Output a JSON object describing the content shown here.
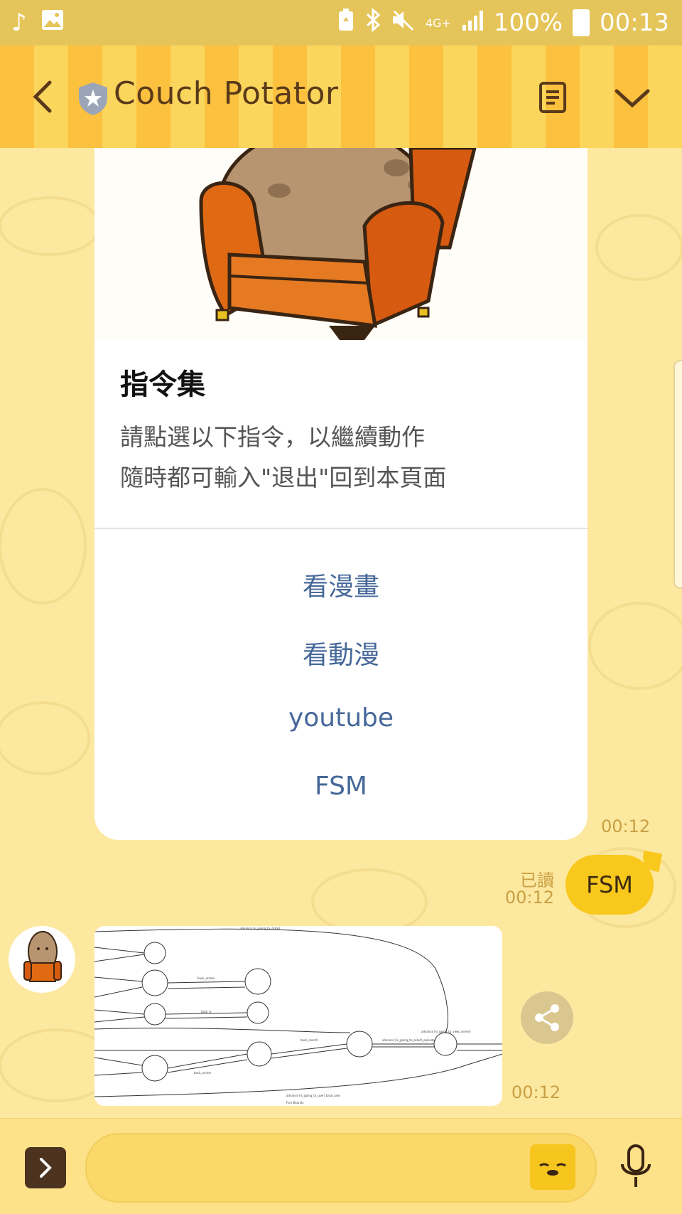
{
  "status_bar": {
    "network": "4G+",
    "battery": "100%",
    "time": "00:13"
  },
  "header": {
    "title": "Couch Potator"
  },
  "card": {
    "title": "指令集",
    "description_line1": "請點選以下指令，以繼續動作",
    "description_line2": "隨時都可輸入\"退出\"回到本頁面",
    "actions": [
      "看漫畫",
      "看動漫",
      "youtube",
      "FSM"
    ],
    "time": "00:12"
  },
  "sent_message": {
    "text": "FSM",
    "read_label": "已讀",
    "time": "00:12"
  },
  "image_message": {
    "time": "00:12"
  },
  "colors": {
    "accent": "#f8c81d",
    "link": "#46689a",
    "header_stripe_a": "#fbc13f",
    "header_stripe_b": "#fbd65c"
  }
}
